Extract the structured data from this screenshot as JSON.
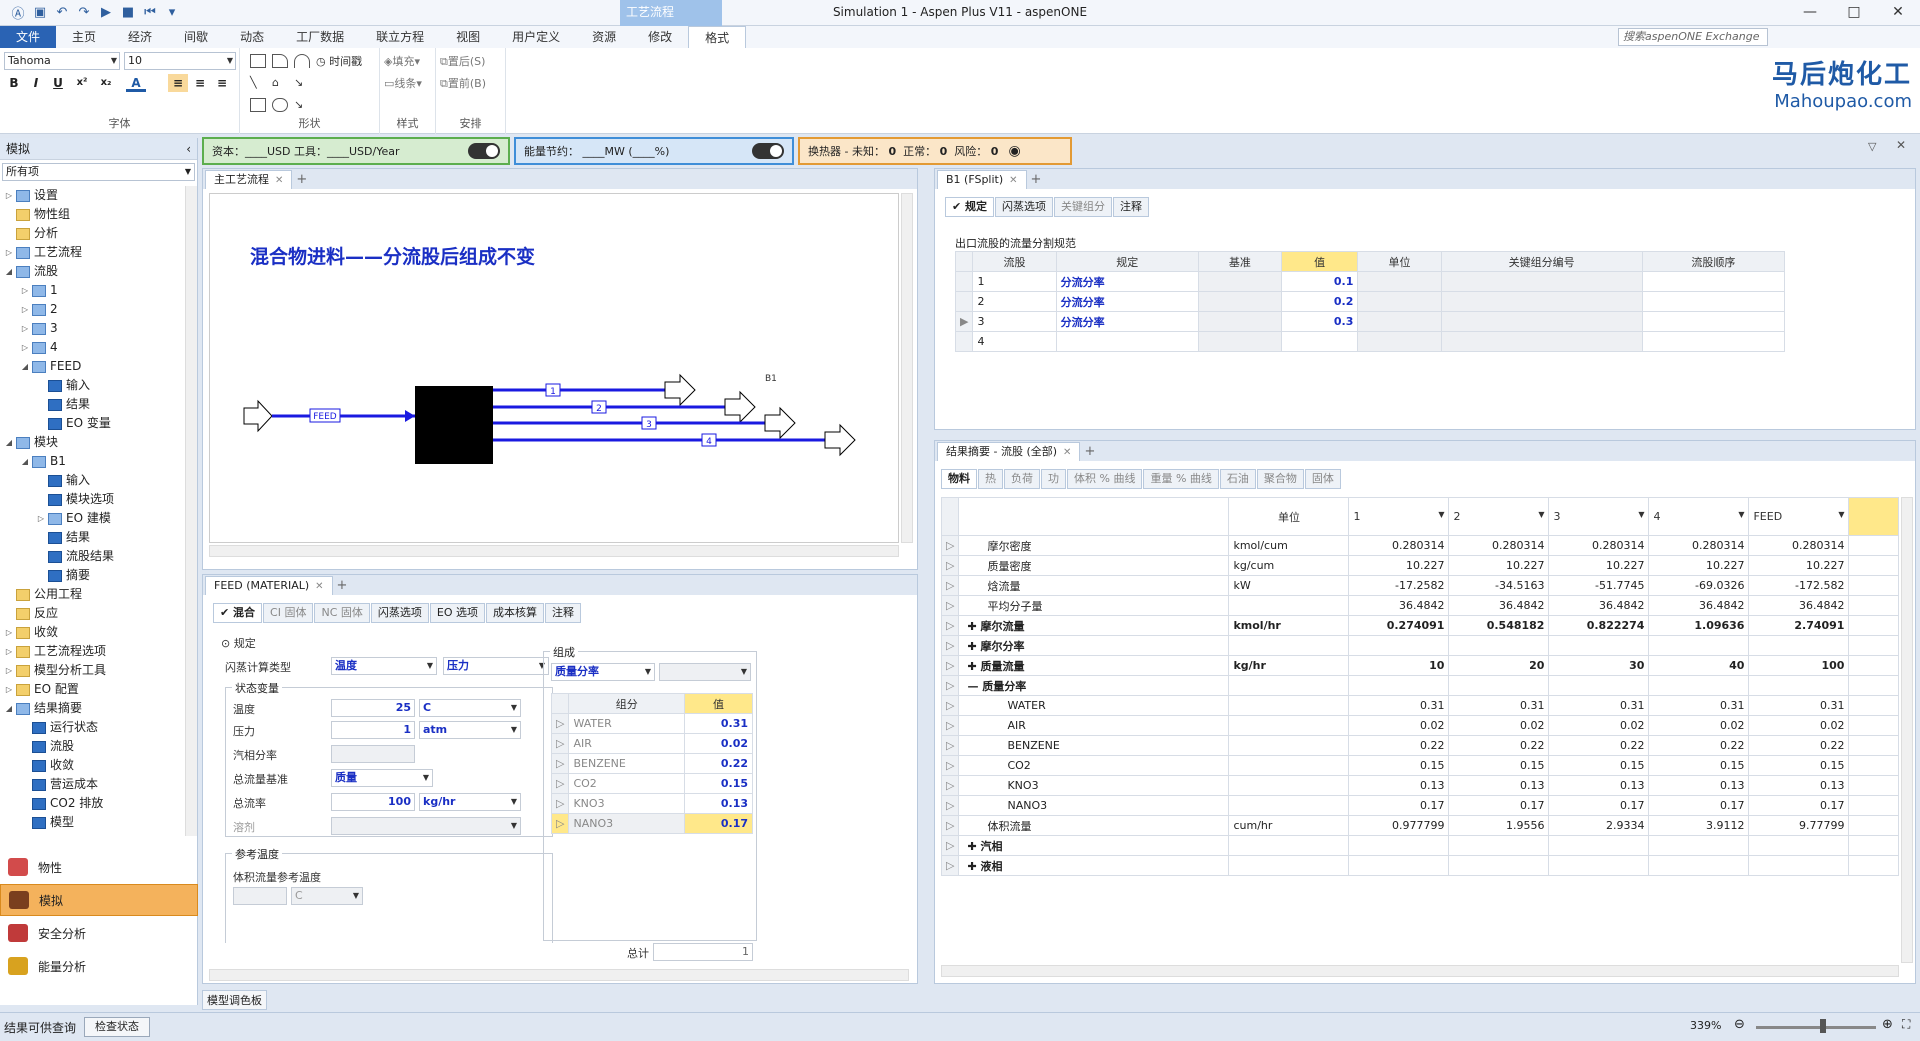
{
  "window": {
    "title": "Simulation 1 - Aspen Plus V11 - aspenONE",
    "context_tab": "工艺流程",
    "controls": [
      "—",
      "□",
      "✕"
    ]
  },
  "ribbon": {
    "tabs": [
      "文件",
      "主页",
      "经济",
      "间歇",
      "动态",
      "工厂数据",
      "联立方程",
      "视图",
      "用户定义",
      "资源",
      "修改",
      "格式"
    ],
    "search_placeholder": "搜索aspenONE Exchange",
    "font_name": "Tahoma",
    "font_size": "10",
    "groups": [
      "字体",
      "形状",
      "样式",
      "安排"
    ],
    "timestamp_label": "时间戳",
    "fill_label": "填充",
    "line_label": "线条",
    "front_label": "置后(S)",
    "back_label": "置前(B)"
  },
  "brand": {
    "cn": "马后炮化工",
    "en": "Mahoupao.com"
  },
  "left_pane": {
    "title": "模拟",
    "filter": "所有项",
    "tree": [
      {
        "label": "设置",
        "level": 0,
        "exp": "▷",
        "icon": "bluef"
      },
      {
        "label": "物性组",
        "level": 0,
        "exp": "",
        "icon": "folder"
      },
      {
        "label": "分析",
        "level": 0,
        "exp": "",
        "icon": "folder"
      },
      {
        "label": "工艺流程",
        "level": 0,
        "exp": "▷",
        "icon": "bluef"
      },
      {
        "label": "流股",
        "level": 0,
        "exp": "◢",
        "icon": "bluef"
      },
      {
        "label": "1",
        "level": 1,
        "exp": "▷",
        "icon": "bluef"
      },
      {
        "label": "2",
        "level": 1,
        "exp": "▷",
        "icon": "bluef"
      },
      {
        "label": "3",
        "level": 1,
        "exp": "▷",
        "icon": "bluef"
      },
      {
        "label": "4",
        "level": 1,
        "exp": "▷",
        "icon": "bluef"
      },
      {
        "label": "FEED",
        "level": 1,
        "exp": "◢",
        "icon": "bluef"
      },
      {
        "label": "输入",
        "level": 2,
        "exp": "",
        "icon": "check"
      },
      {
        "label": "结果",
        "level": 2,
        "exp": "",
        "icon": "check"
      },
      {
        "label": "EO 变量",
        "level": 2,
        "exp": "",
        "icon": "check"
      },
      {
        "label": "模块",
        "level": 0,
        "exp": "◢",
        "icon": "bluef"
      },
      {
        "label": "B1",
        "level": 1,
        "exp": "◢",
        "icon": "bluef"
      },
      {
        "label": "输入",
        "level": 2,
        "exp": "",
        "icon": "check"
      },
      {
        "label": "模块选项",
        "level": 2,
        "exp": "",
        "icon": "check"
      },
      {
        "label": "EO 建模",
        "level": 2,
        "exp": "▷",
        "icon": "bluef"
      },
      {
        "label": "结果",
        "level": 2,
        "exp": "",
        "icon": "check"
      },
      {
        "label": "流股结果",
        "level": 2,
        "exp": "",
        "icon": "check"
      },
      {
        "label": "摘要",
        "level": 2,
        "exp": "",
        "icon": "check"
      },
      {
        "label": "公用工程",
        "level": 0,
        "exp": "",
        "icon": "folder"
      },
      {
        "label": "反应",
        "level": 0,
        "exp": "",
        "icon": "folder"
      },
      {
        "label": "收敛",
        "level": 0,
        "exp": "▷",
        "icon": "folder"
      },
      {
        "label": "工艺流程选项",
        "level": 0,
        "exp": "▷",
        "icon": "folder"
      },
      {
        "label": "模型分析工具",
        "level": 0,
        "exp": "▷",
        "icon": "folder"
      },
      {
        "label": "EO 配置",
        "level": 0,
        "exp": "▷",
        "icon": "folder"
      },
      {
        "label": "结果摘要",
        "level": 0,
        "exp": "◢",
        "icon": "bluef"
      },
      {
        "label": "运行状态",
        "level": 1,
        "exp": "",
        "icon": "check"
      },
      {
        "label": "流股",
        "level": 1,
        "exp": "",
        "icon": "check"
      },
      {
        "label": "收敛",
        "level": 1,
        "exp": "",
        "icon": "check"
      },
      {
        "label": "营运成本",
        "level": 1,
        "exp": "",
        "icon": "check"
      },
      {
        "label": "CO2 排放",
        "level": 1,
        "exp": "",
        "icon": "check"
      },
      {
        "label": "模型",
        "level": 1,
        "exp": "",
        "icon": "check"
      }
    ],
    "nav": [
      "物性",
      "模拟",
      "安全分析",
      "能量分析"
    ]
  },
  "infobars": {
    "capital": "资本：____USD   工具：____USD/Year",
    "energy": "能量节约： ____MW   (____%)",
    "hx_label": "换热器 - 未知：",
    "hx_unknown": "0",
    "hx_normal_label": "正常：",
    "hx_normal": "0",
    "hx_risk_label": "风险：",
    "hx_risk": "0"
  },
  "flowsheet": {
    "tab": "主工艺流程",
    "title": "混合物进料——分流股后组成不变",
    "block": "B1",
    "feed": "FEED",
    "streams": [
      "1",
      "2",
      "3",
      "4"
    ]
  },
  "fsplit": {
    "tab": "B1 (FSplit)",
    "subtabs": [
      "规定",
      "闪蒸选项",
      "关键组分",
      "注释"
    ],
    "section": "出口流股的流量分割规范",
    "columns": [
      "流股",
      "规定",
      "基准",
      "值",
      "单位",
      "关键组分编号",
      "流股顺序"
    ],
    "rows": [
      {
        "stream": "1",
        "spec": "分流分率",
        "value": "0.1"
      },
      {
        "stream": "2",
        "spec": "分流分率",
        "value": "0.2"
      },
      {
        "stream": "3",
        "spec": "分流分率",
        "value": "0.3"
      },
      {
        "stream": "4",
        "spec": "",
        "value": ""
      }
    ]
  },
  "feed_panel": {
    "tab": "FEED (MATERIAL)",
    "subtabs": [
      "混合",
      "CI 固体",
      "NC 固体",
      "闪蒸选项",
      "EO 选项",
      "成本核算",
      "注释"
    ],
    "spec_label": "规定",
    "flash_type_label": "闪蒸计算类型",
    "flash_type_1": "温度",
    "flash_type_2": "压力",
    "state_vars": "状态变量",
    "temp_label": "温度",
    "temp_value": "25",
    "temp_unit": "C",
    "pres_label": "压力",
    "pres_value": "1",
    "pres_unit": "atm",
    "vfrac_label": "汽相分率",
    "basis_label": "总流量基准",
    "basis_value": "质量",
    "rate_label": "总流率",
    "rate_value": "100",
    "rate_unit": "kg/hr",
    "solvent_label": "溶剂",
    "ref_temp": "参考温度",
    "vol_ref_temp": "体积流量参考温度",
    "vol_ref_unit": "C",
    "comp_label": "组成",
    "comp_basis": "质量分率",
    "comp_col": "组分",
    "val_col": "值",
    "components": [
      {
        "name": "WATER",
        "value": "0.31"
      },
      {
        "name": "AIR",
        "value": "0.02"
      },
      {
        "name": "BENZENE",
        "value": "0.22"
      },
      {
        "name": "CO2",
        "value": "0.15"
      },
      {
        "name": "KNO3",
        "value": "0.13"
      },
      {
        "name": "NANO3",
        "value": "0.17"
      }
    ],
    "total_label": "总计",
    "total_value": "1"
  },
  "results": {
    "tab": "结果摘要 - 流股 (全部)",
    "subtabs": [
      "物料",
      "热",
      "负荷",
      "功",
      "体积 % 曲线",
      "重量 % 曲线",
      "石油",
      "聚合物",
      "固体"
    ],
    "unit_header": "单位",
    "stream_cols": [
      "1",
      "2",
      "3",
      "4",
      "FEED"
    ],
    "rows": [
      {
        "label": "摩尔密度",
        "unit": "kmol/cum",
        "vals": [
          "0.280314",
          "0.280314",
          "0.280314",
          "0.280314",
          "0.280314"
        ],
        "bold": false,
        "indent": 1
      },
      {
        "label": "质量密度",
        "unit": "kg/cum",
        "vals": [
          "10.227",
          "10.227",
          "10.227",
          "10.227",
          "10.227"
        ],
        "bold": false,
        "indent": 1
      },
      {
        "label": "焓流量",
        "unit": "kW",
        "vals": [
          "-17.2582",
          "-34.5163",
          "-51.7745",
          "-69.0326",
          "-172.582"
        ],
        "bold": false,
        "indent": 1
      },
      {
        "label": "平均分子量",
        "unit": "",
        "vals": [
          "36.4842",
          "36.4842",
          "36.4842",
          "36.4842",
          "36.4842"
        ],
        "bold": false,
        "indent": 1
      },
      {
        "label": "✚ 摩尔流量",
        "unit": "kmol/hr",
        "vals": [
          "0.274091",
          "0.548182",
          "0.822274",
          "1.09636",
          "2.74091"
        ],
        "bold": true,
        "indent": 0
      },
      {
        "label": "✚ 摩尔分率",
        "unit": "",
        "vals": [
          "",
          "",
          "",
          "",
          ""
        ],
        "bold": true,
        "indent": 0
      },
      {
        "label": "✚ 质量流量",
        "unit": "kg/hr",
        "vals": [
          "10",
          "20",
          "30",
          "40",
          "100"
        ],
        "bold": true,
        "indent": 0
      },
      {
        "label": "— 质量分率",
        "unit": "",
        "vals": [
          "",
          "",
          "",
          "",
          ""
        ],
        "bold": true,
        "indent": 0
      },
      {
        "label": "WATER",
        "unit": "",
        "vals": [
          "0.31",
          "0.31",
          "0.31",
          "0.31",
          "0.31"
        ],
        "bold": false,
        "indent": 2
      },
      {
        "label": "AIR",
        "unit": "",
        "vals": [
          "0.02",
          "0.02",
          "0.02",
          "0.02",
          "0.02"
        ],
        "bold": false,
        "indent": 2
      },
      {
        "label": "BENZENE",
        "unit": "",
        "vals": [
          "0.22",
          "0.22",
          "0.22",
          "0.22",
          "0.22"
        ],
        "bold": false,
        "indent": 2
      },
      {
        "label": "CO2",
        "unit": "",
        "vals": [
          "0.15",
          "0.15",
          "0.15",
          "0.15",
          "0.15"
        ],
        "bold": false,
        "indent": 2
      },
      {
        "label": "KNO3",
        "unit": "",
        "vals": [
          "0.13",
          "0.13",
          "0.13",
          "0.13",
          "0.13"
        ],
        "bold": false,
        "indent": 2
      },
      {
        "label": "NANO3",
        "unit": "",
        "vals": [
          "0.17",
          "0.17",
          "0.17",
          "0.17",
          "0.17"
        ],
        "bold": false,
        "indent": 2
      },
      {
        "label": "体积流量",
        "unit": "cum/hr",
        "vals": [
          "0.977799",
          "1.9556",
          "2.9334",
          "3.9112",
          "9.77799"
        ],
        "bold": false,
        "indent": 1
      },
      {
        "label": "✚ 汽相",
        "unit": "",
        "vals": [
          "",
          "",
          "",
          "",
          ""
        ],
        "bold": true,
        "indent": 0
      },
      {
        "label": "✚ 液相",
        "unit": "",
        "vals": [
          "",
          "",
          "",
          "",
          ""
        ],
        "bold": true,
        "indent": 0
      }
    ]
  },
  "palette_tab": "模型调色板",
  "status": {
    "left": "结果可供查询",
    "check_btn": "检查状态",
    "zoom": "339%"
  }
}
